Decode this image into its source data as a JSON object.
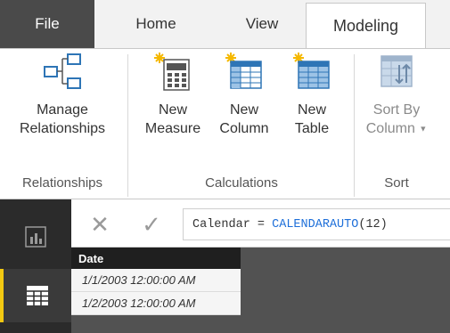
{
  "tabs": {
    "file": "File",
    "home": "Home",
    "view": "View",
    "modeling": "Modeling"
  },
  "ribbon": {
    "relationships": {
      "manage_line1": "Manage",
      "manage_line2": "Relationships",
      "group_label": "Relationships"
    },
    "calculations": {
      "new_measure_line1": "New",
      "new_measure_line2": "Measure",
      "new_column_line1": "New",
      "new_column_line2": "Column",
      "new_table_line1": "New",
      "new_table_line2": "Table",
      "group_label": "Calculations"
    },
    "sort": {
      "sort_by_line1": "Sort By",
      "sort_by_line2": "Column",
      "group_label": "Sort"
    }
  },
  "formula_bar": {
    "cancel_glyph": "✕",
    "commit_glyph": "✓",
    "formula_prefix": "Calendar = ",
    "formula_function": "CALENDARAUTO",
    "formula_args": "(12)"
  },
  "table": {
    "header": "Date",
    "rows": [
      "1/1/2003 12:00:00 AM",
      "1/2/2003 12:00:00 AM"
    ]
  },
  "colors": {
    "file_tab": "#4a4a4a",
    "rail": "#2b2b2b",
    "active_accent": "#f2c811",
    "function_blue": "#1e6fd9"
  },
  "icons": {
    "report_view": "bar-chart-icon",
    "data_view": "table-grid-icon",
    "manage_relationships": "relationships-icon",
    "new_measure": "calculator-icon",
    "new_column": "new-column-icon",
    "new_table": "new-table-icon",
    "sort_by_column": "sort-icon"
  }
}
